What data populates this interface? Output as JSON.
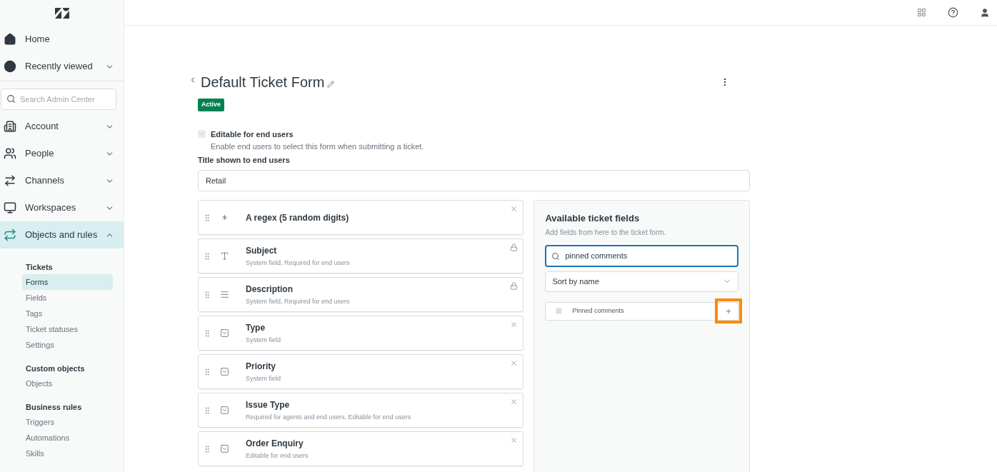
{
  "sidebar": {
    "nav_top": [
      {
        "label": "Home",
        "selected": false
      },
      {
        "label": "Recently viewed",
        "expanded": false,
        "selected": false
      }
    ],
    "search": {
      "placeholder": "Search Admin Center"
    },
    "nav": [
      {
        "label": "Account",
        "expanded": false,
        "selected": false
      },
      {
        "label": "People",
        "expanded": false,
        "selected": false
      },
      {
        "label": "Channels",
        "expanded": false,
        "selected": false
      },
      {
        "label": "Workspaces",
        "expanded": false,
        "selected": false
      },
      {
        "label": "Objects and rules",
        "expanded": true,
        "selected": true
      }
    ],
    "sections": [
      {
        "heading": "Tickets",
        "items": [
          {
            "label": "Forms",
            "selected": true
          },
          {
            "label": "Fields",
            "selected": false
          },
          {
            "label": "Tags",
            "selected": false
          },
          {
            "label": "Ticket statuses",
            "selected": false
          },
          {
            "label": "Settings",
            "selected": false
          }
        ]
      },
      {
        "heading": "Custom objects",
        "items": [
          {
            "label": "Objects",
            "selected": false
          }
        ]
      },
      {
        "heading": "Business rules",
        "items": [
          {
            "label": "Triggers",
            "selected": false
          },
          {
            "label": "Automations",
            "selected": false
          },
          {
            "label": "Skills",
            "selected": false
          }
        ]
      }
    ]
  },
  "form": {
    "title": "Default Ticket Form",
    "status": "Active",
    "editable": {
      "label": "Editable for end users",
      "hint": "Enable end users to select this form when submitting a ticket.",
      "checked": true,
      "disabled": true
    },
    "title_field": {
      "label": "Title shown to end users",
      "value": "Retail"
    },
    "fields": [
      {
        "name": "A regex (5 random digits)",
        "kind": "regex",
        "locked": false
      },
      {
        "name": "Subject",
        "description": "System field, Required for end users",
        "kind": "text",
        "locked": true
      },
      {
        "name": "Description",
        "description": "System field, Required for end users",
        "kind": "multiline",
        "locked": true
      },
      {
        "name": "Type",
        "description": "System field",
        "kind": "dropdown",
        "locked": false
      },
      {
        "name": "Priority",
        "description": "System field",
        "kind": "dropdown",
        "locked": false
      },
      {
        "name": "Issue Type",
        "description": "Required for agents and end users, Editable for end users",
        "kind": "dropdown",
        "locked": false
      },
      {
        "name": "Order Enquiry",
        "description": "Editable for end users",
        "kind": "dropdown",
        "locked": false
      }
    ]
  },
  "available": {
    "title": "Available ticket fields",
    "subtitle": "Add fields from here to the ticket form.",
    "search": {
      "value": "pinned comments"
    },
    "sort": {
      "value": "Sort by name"
    },
    "fields": [
      {
        "name": "Pinned comments",
        "kind": "multiline",
        "highlighted": true
      }
    ]
  }
}
